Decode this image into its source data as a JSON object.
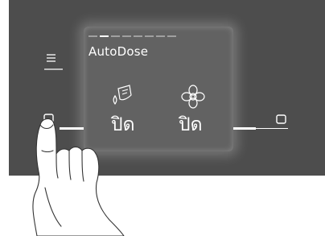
{
  "display": {
    "progress_total": 8,
    "progress_active_index": 1,
    "autodose_label": "AutoDose",
    "options": [
      {
        "icon": "detergent-drop-icon",
        "state_label": "ปิด"
      },
      {
        "icon": "flower-icon",
        "state_label": "ปิด"
      }
    ]
  },
  "colors": {
    "panel": "#4d4d4d",
    "text": "#ffffff",
    "progress_inactive": "#a0a0a0"
  }
}
